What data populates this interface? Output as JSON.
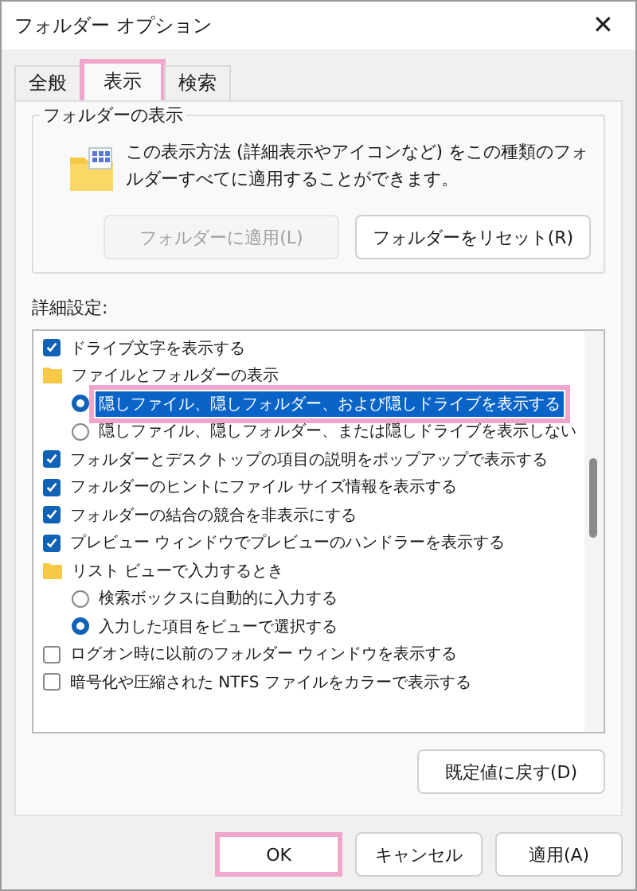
{
  "window": {
    "title": "フォルダー オプション",
    "close": "✕"
  },
  "tabs": [
    {
      "label": "全般",
      "selected": false,
      "highlighted": false
    },
    {
      "label": "表示",
      "selected": true,
      "highlighted": true
    },
    {
      "label": "検索",
      "selected": false,
      "highlighted": false
    }
  ],
  "folder_view": {
    "title": "フォルダーの表示",
    "description": "この表示方法 (詳細表示やアイコンなど) をこの種類のフォルダーすべてに適用することができます。",
    "buttons": [
      {
        "label": "フォルダーに適用(L)",
        "disabled": true
      },
      {
        "label": "フォルダーをリセット(R)",
        "disabled": false
      }
    ]
  },
  "advanced": {
    "label": "詳細設定:",
    "items": [
      {
        "kind": "checkbox",
        "label": "ドライブ文字を表示する",
        "checked": true,
        "selected": false,
        "highlighted": false
      },
      {
        "kind": "folder",
        "label": "ファイルとフォルダーの表示",
        "selected": false,
        "children": [
          {
            "kind": "radio",
            "label": "隠しファイル、隠しフォルダー、および隠しドライブを表示する",
            "checked": true,
            "selected": true,
            "highlighted": true
          },
          {
            "kind": "radio",
            "label": "隠しファイル、隠しフォルダー、または隠しドライブを表示しない",
            "checked": false,
            "selected": false,
            "highlighted": false
          }
        ]
      },
      {
        "kind": "checkbox",
        "label": "フォルダーとデスクトップの項目の説明をポップアップで表示する",
        "checked": true,
        "selected": false,
        "highlighted": false
      },
      {
        "kind": "checkbox",
        "label": "フォルダーのヒントにファイル サイズ情報を表示する",
        "checked": true,
        "selected": false,
        "highlighted": false
      },
      {
        "kind": "checkbox",
        "label": "フォルダーの結合の競合を非表示にする",
        "checked": true,
        "selected": false,
        "highlighted": false
      },
      {
        "kind": "checkbox",
        "label": "プレビュー ウィンドウでプレビューのハンドラーを表示する",
        "checked": true,
        "selected": false,
        "highlighted": false
      },
      {
        "kind": "folder",
        "label": "リスト ビューで入力するとき",
        "selected": false,
        "children": [
          {
            "kind": "radio",
            "label": "検索ボックスに自動的に入力する",
            "checked": false,
            "selected": false,
            "highlighted": false
          },
          {
            "kind": "radio",
            "label": "入力した項目をビューで選択する",
            "checked": true,
            "selected": false,
            "highlighted": false
          }
        ]
      },
      {
        "kind": "checkbox",
        "label": "ログオン時に以前のフォルダー ウィンドウを表示する",
        "checked": false,
        "selected": false,
        "highlighted": false
      },
      {
        "kind": "checkbox",
        "label": "暗号化や圧縮された NTFS ファイルをカラーで表示する",
        "checked": false,
        "selected": false,
        "highlighted": false
      }
    ],
    "restore_button": "既定値に戻す(D)"
  },
  "buttons": [
    {
      "label": "OK",
      "highlighted": true
    },
    {
      "label": "キャンセル",
      "highlighted": false
    },
    {
      "label": "適用(A)",
      "highlighted": false
    }
  ]
}
